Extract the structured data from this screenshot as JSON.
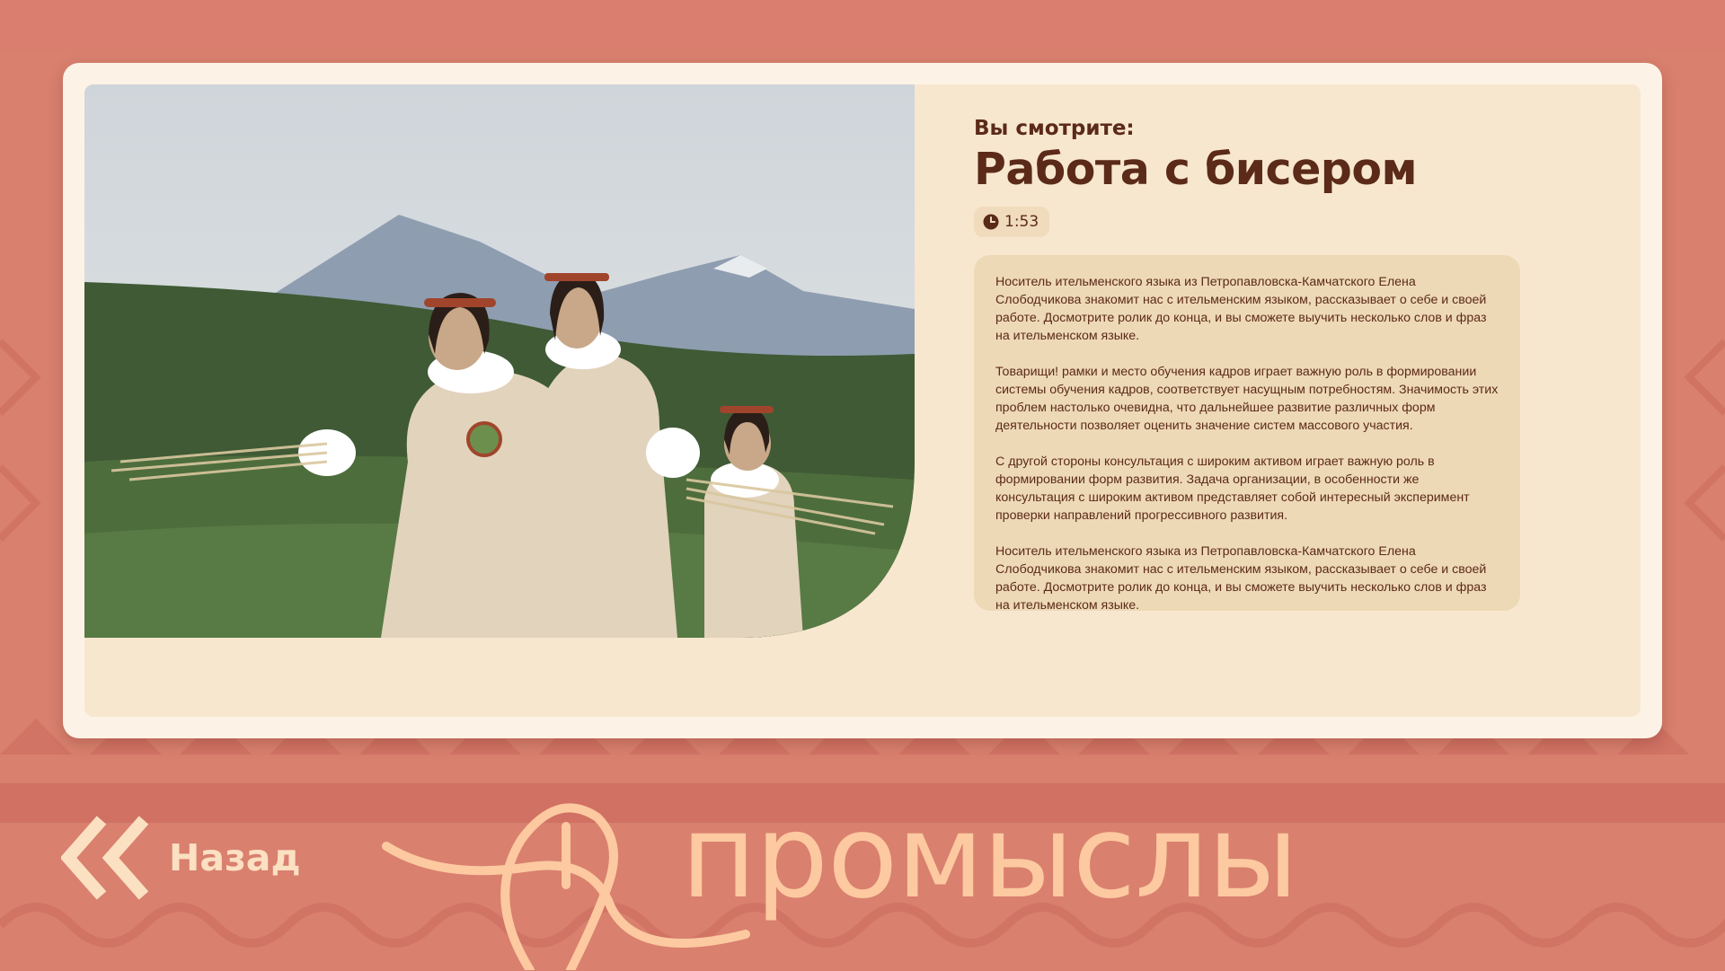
{
  "colors": {
    "background": "#d9806f",
    "card": "#fdf2e6",
    "card_inner": "#f8e7cf",
    "text_dark": "#5b2a19",
    "description_box": "#eed9b6",
    "accent_light": "#fcc9a0"
  },
  "video": {
    "watching_label": "Вы смотрите:",
    "title": "Работа с бисером",
    "duration": "1:53",
    "duration_icon": "clock-icon",
    "photo_alt": "photo",
    "paragraphs": [
      "Носитель ительменского языка из Петропавловска-Камчатского Елена Слободчикова знакомит нас с ительменским языком, рассказывает о себе и своей работе. Досмотрите ролик до конца, и вы сможете выучить несколько слов и фраз на ительменском языке.",
      "Товарищи! рамки и место обучения кадров играет важную роль в формировании системы обучения кадров, соответствует насущным потребностям. Значимость этих проблем настолько очевидна, что дальнейшее развитие различных форм деятельности позволяет оценить значение систем массового участия.",
      "С другой стороны консультация с широким активом играет важную роль в формировании форм развития. Задача организации, в особенности же консультация с широким активом представляет собой интересный эксперимент проверки направлений прогрессивного развития.",
      "Носитель ительменского языка из Петропавловска-Камчатского Елена Слободчикова знакомит нас с ительменским языком, рассказывает о себе и своей работе. Досмотрите ролик до конца, и вы сможете выучить несколько слов и фраз на ительменском языке."
    ]
  },
  "footer": {
    "back_label": "Назад",
    "back_icon": "double-chevron-left-icon",
    "section_title": "промыслы"
  }
}
